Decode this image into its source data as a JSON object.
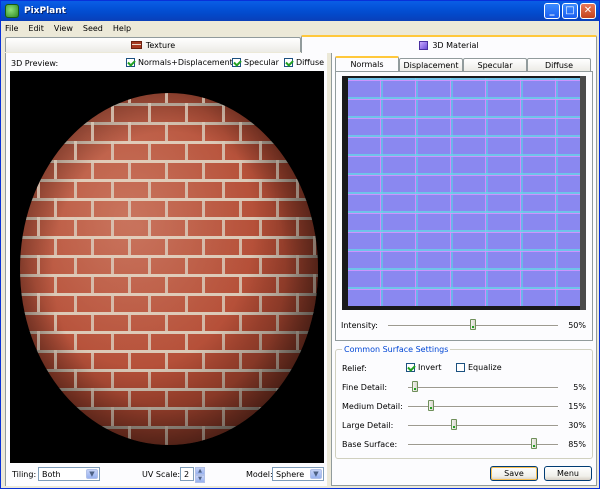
{
  "window": {
    "title": "PixPlant"
  },
  "menu": [
    "File",
    "Edit",
    "View",
    "Seed",
    "Help"
  ],
  "top_tabs": [
    {
      "label": "Texture",
      "icon": "brick-icon",
      "active": false
    },
    {
      "label": "3D Material",
      "icon": "cube-icon",
      "active": true
    }
  ],
  "preview": {
    "label": "3D Preview:",
    "options": [
      {
        "label": "Normals+Displacement",
        "checked": true
      },
      {
        "label": "Specular",
        "checked": true
      },
      {
        "label": "Diffuse",
        "checked": true
      }
    ]
  },
  "bottom": {
    "tiling_label": "Tiling:",
    "tiling_value": "Both",
    "uvscale_label": "UV Scale:",
    "uvscale_value": "2",
    "model_label": "Model:",
    "model_value": "Sphere"
  },
  "material_tabs": [
    {
      "label": "Normals",
      "active": true
    },
    {
      "label": "Displacement",
      "active": false
    },
    {
      "label": "Specular",
      "active": false
    },
    {
      "label": "Diffuse",
      "active": false
    }
  ],
  "intensity": {
    "label": "Intensity:",
    "value": "50%",
    "fraction": 0.5
  },
  "surface": {
    "title": "Common Surface Settings",
    "relief_label": "Relief:",
    "invert_label": "Invert",
    "invert_checked": true,
    "equalize_label": "Equalize",
    "equalize_checked": false,
    "sliders": [
      {
        "label": "Fine Detail:",
        "value": "5%",
        "fraction": 0.05
      },
      {
        "label": "Medium Detail:",
        "value": "15%",
        "fraction": 0.15
      },
      {
        "label": "Large Detail:",
        "value": "30%",
        "fraction": 0.3
      },
      {
        "label": "Base Surface:",
        "value": "85%",
        "fraction": 0.85
      }
    ]
  },
  "buttons": {
    "save": "Save",
    "menu": "Menu"
  },
  "colors": {
    "titlebar": "#0351d6",
    "group_title": "#0046d5",
    "check": "#21a121"
  }
}
